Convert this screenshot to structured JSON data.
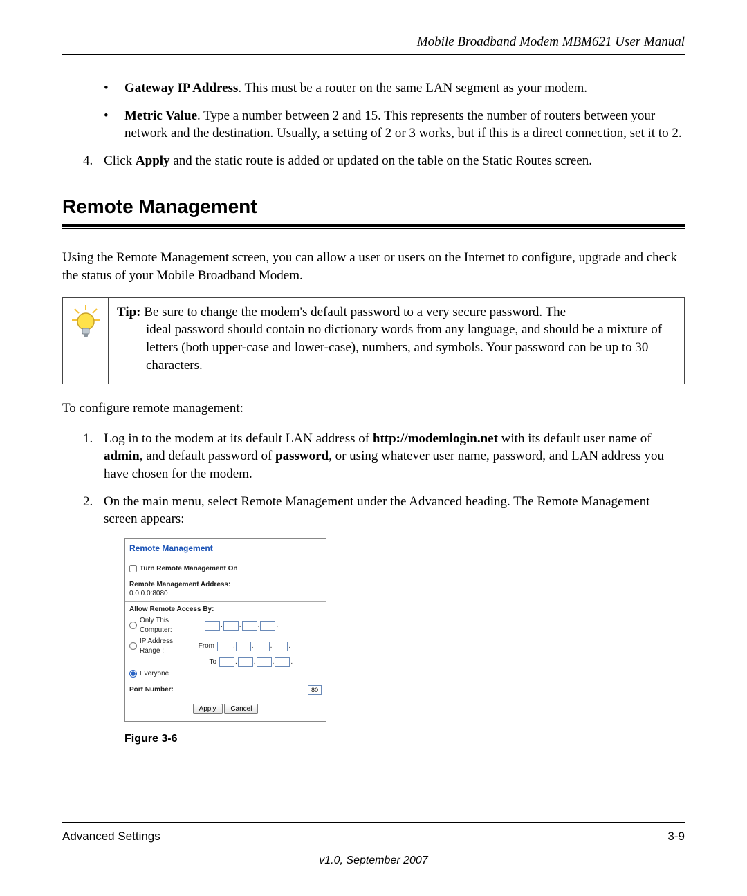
{
  "header": {
    "doc_title": "Mobile Broadband Modem MBM621 User Manual"
  },
  "bullets": {
    "b1_label": "Gateway IP Address",
    "b1_text": ". This must be a router on the same LAN segment as your modem.",
    "b2_label": "Metric Value",
    "b2_text": ". Type a number between 2 and 15. This represents the number of routers between your network and the destination. Usually, a setting of 2 or 3 works, but if this is a direct connection, set it to 2."
  },
  "step4": {
    "num": "4.",
    "pre": "Click ",
    "bold": "Apply",
    "post": " and the static route is added or updated on the table on the Static Routes screen."
  },
  "section_heading": "Remote Management",
  "intro_para": "Using the Remote Management screen, you can allow a user or users on the Internet to configure, upgrade and check the status of your Mobile Broadband Modem.",
  "tip": {
    "label": "Tip:",
    "first_line": " Be sure to change the modem's default password to a very secure password. The",
    "rest": "ideal password should contain no dictionary words from any language, and should be a mixture of letters (both upper-case and lower-case), numbers, and symbols. Your password can be up to 30 characters."
  },
  "configure_line": "To configure remote management:",
  "step1": {
    "num": "1.",
    "t1": "Log in to the modem at its default LAN address of ",
    "b1": "http://modemlogin.net",
    "t2": " with its default user name of ",
    "b2": "admin",
    "t3": ", and default password of ",
    "b3": "password",
    "t4": ", or using whatever user name, password, and LAN address you have chosen for the modem."
  },
  "step2": {
    "num": "2.",
    "text": "On the main menu, select Remote Management under the Advanced heading. The Remote Management screen appears:"
  },
  "figure": {
    "title": "Remote Management",
    "turn_on": "Turn Remote Management On",
    "addr_label": "Remote Management Address:",
    "addr_value": "0.0.0.0:8080",
    "allow_label": "Allow Remote Access By:",
    "only_this": "Only This Computer:",
    "ip_range": "IP Address Range :",
    "from": "From",
    "to": "To",
    "everyone": "Everyone",
    "port_label": "Port Number:",
    "port_value": "80",
    "apply": "Apply",
    "cancel": "Cancel",
    "caption": "Figure 3-6"
  },
  "footer": {
    "left": "Advanced Settings",
    "right": "3-9",
    "version": "v1.0, September 2007"
  }
}
